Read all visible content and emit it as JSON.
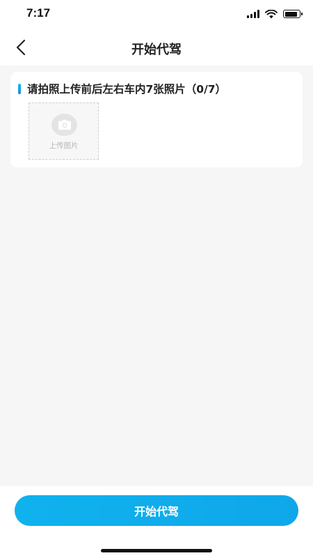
{
  "status_bar": {
    "time": "7:17",
    "icons": [
      "signal-icon",
      "wifi-icon",
      "battery-icon"
    ],
    "battery_level": 0.9
  },
  "header": {
    "back_icon": "chevron-left-icon",
    "title": "开始代驾"
  },
  "photo_card": {
    "title": "请拍照上传前后左右车内7张照片（0/7）",
    "accent_color": "#1d9fe9",
    "upload_tile": {
      "icon": "camera-icon",
      "label": "上传图片"
    }
  },
  "footer": {
    "start_button_label": "开始代驾",
    "button_color": "#10aeed"
  }
}
